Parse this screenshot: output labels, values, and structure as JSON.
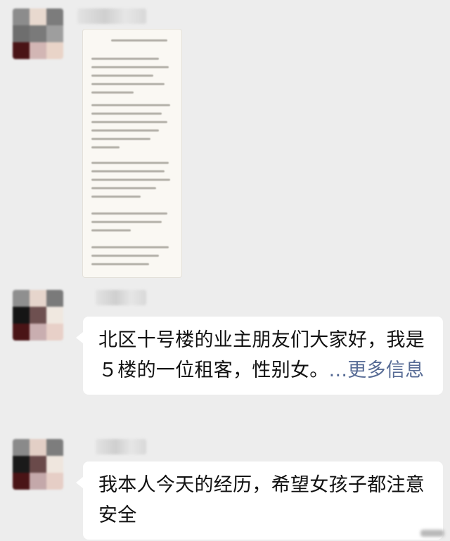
{
  "messages": [
    {
      "type": "image-document"
    },
    {
      "type": "text",
      "text": "北区十号楼的业主朋友们大家好，我是５楼的一位租客，性别女。",
      "more_label": "...更多信息"
    },
    {
      "type": "text",
      "text": "我本人今天的经历，希望女孩子都注意安全"
    }
  ],
  "colors": {
    "background": "#ededed",
    "bubble": "#ffffff",
    "link": "#576b95"
  }
}
